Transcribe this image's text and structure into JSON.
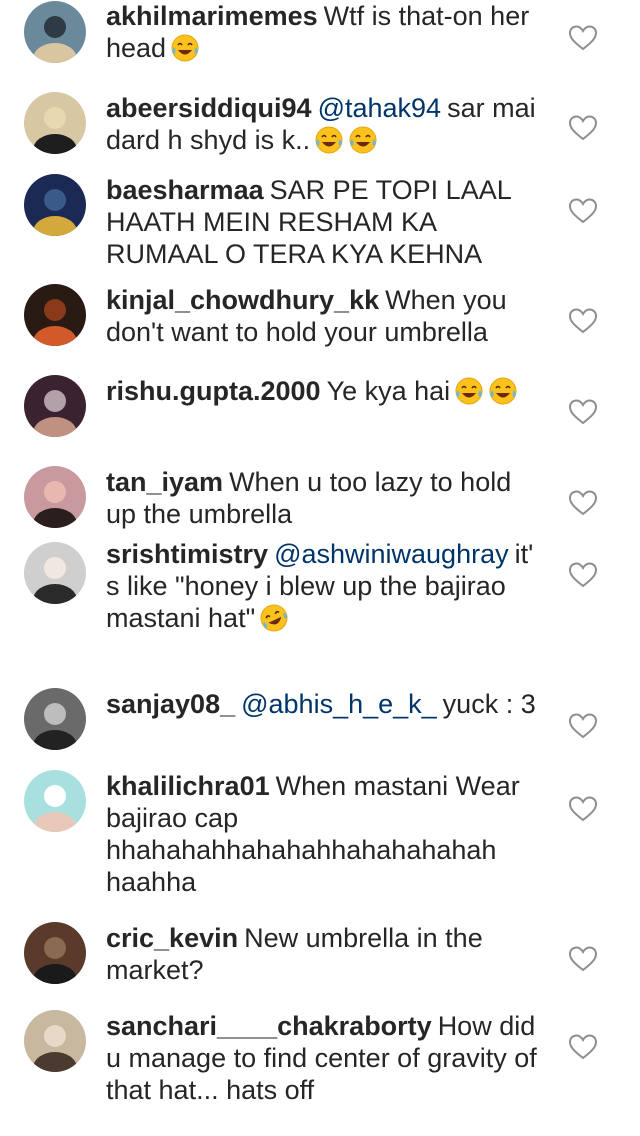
{
  "comments": [
    {
      "username": "akhilmarimemes",
      "mention": "",
      "text": "Wtf is that-on her head",
      "emojis": [
        "face-with-tears-of-joy"
      ]
    },
    {
      "username": "abeersiddiqui94",
      "mention": "@tahak94",
      "text": "sar mai dard h shyd is k..",
      "emojis": [
        "face-with-tears-of-joy",
        "face-with-tears-of-joy"
      ]
    },
    {
      "username": "baesharmaa",
      "mention": "",
      "text": "SAR PE TOPI LAAL HAATH MEIN RESHAM KA RUMAAL O TERA KYA KEHNA",
      "emojis": []
    },
    {
      "username": "kinjal_chowdhury_kk",
      "mention": "",
      "text": "When you don't want to hold your umbrella",
      "emojis": []
    },
    {
      "username": "rishu.gupta.2000",
      "mention": "",
      "text": "Ye kya hai",
      "emojis": [
        "face-with-tears-of-joy",
        "face-with-tears-of-joy"
      ]
    },
    {
      "username": "tan_iyam",
      "mention": "",
      "text": "When u too lazy to hold up the umbrella",
      "emojis": []
    },
    {
      "username": "srishtimistry",
      "mention": "@ashwiniwaughray",
      "text": "it's like \"honey i blew up the bajirao mastani hat\"",
      "emojis": [
        "rolling-on-floor-laughing"
      ]
    },
    {
      "username": "sanjay08_",
      "mention": "@abhis_h_e_k_",
      "text": "yuck : 3",
      "emojis": []
    },
    {
      "username": "khalilichra01",
      "mention": "",
      "text": "When mastani Wear bajirao cap hhahahahhahahahhahahahahah haahha",
      "emojis": []
    },
    {
      "username": "cric_kevin",
      "mention": "",
      "text": "New umbrella in the market?",
      "emojis": []
    },
    {
      "username": "sanchari____chakraborty",
      "mention": "",
      "text": "How did u manage to find center of gravity of that hat... hats off",
      "emojis": []
    }
  ],
  "colors": {
    "text": "#262626",
    "mention": "#003569",
    "heart_outline": "#8e8e8e",
    "background": "#ffffff"
  },
  "icons": {
    "like": "heart-outline-icon"
  }
}
